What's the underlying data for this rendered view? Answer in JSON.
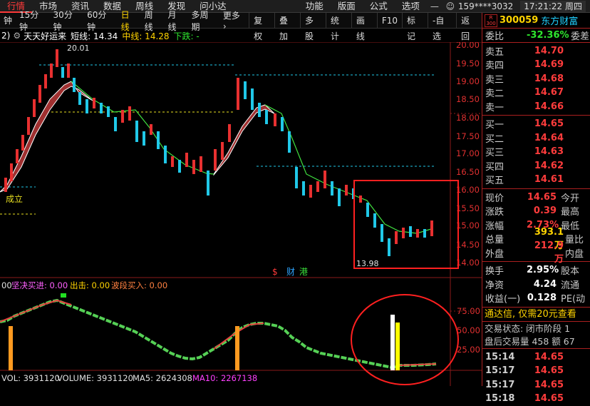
{
  "menu": {
    "items": [
      "行情",
      "市场",
      "资讯",
      "数据",
      "周线",
      "发现",
      "问小达",
      "功能",
      "版面",
      "公式",
      "选项"
    ],
    "account": "159****3032",
    "clock": "17:21:22 周四"
  },
  "toolbar": {
    "periods": [
      "钟",
      "15分钟",
      "30分钟",
      "60分钟",
      "日线",
      "周线",
      "月线",
      "多周期",
      "更多"
    ],
    "active_period": "日线",
    "buttons": [
      "复权",
      "叠加",
      "多股",
      "统计",
      "画线",
      "F10",
      "标记",
      "-自选",
      "返回"
    ]
  },
  "info": {
    "prefix": "2)",
    "indicator": "天天好运来",
    "short_line": "短线: 14.34",
    "mid_line": "中线: 14.28",
    "down": "下跌: -"
  },
  "chart": {
    "price_axis": [
      "20.00",
      "19.50",
      "19.00",
      "18.50",
      "18.00",
      "17.50",
      "17.00",
      "16.50",
      "16.00",
      "15.50",
      "15.00",
      "14.50",
      "14.00"
    ],
    "high_label": "20.01",
    "low_label": "13.98",
    "left_label": "成立",
    "bottom_marks": [
      "$",
      "财",
      "港"
    ],
    "sub_indicator": {
      "prefix": "00",
      "a": "坚决买进: 0.00",
      "b": "出击: 0.00",
      "c": "波段买入: 0.00",
      "axis": [
        "75.00",
        "50.00",
        "25.00"
      ]
    },
    "volume": {
      "vol": "VOL: 3931120",
      "volume": "VOLUME: 3931120",
      "ma5": "MA5: 2624308",
      "ma10": "MA10: 2267138"
    }
  },
  "quote": {
    "code": "300059",
    "name": "东方财富",
    "badge_top": "R",
    "badge_bot": "300",
    "wb": {
      "label": "委比",
      "value": "-32.36%",
      "right": "委差"
    },
    "asks": [
      {
        "l": "卖五",
        "p": "14.70"
      },
      {
        "l": "卖四",
        "p": "14.69"
      },
      {
        "l": "卖三",
        "p": "14.68"
      },
      {
        "l": "卖二",
        "p": "14.67"
      },
      {
        "l": "卖一",
        "p": "14.66"
      }
    ],
    "bids": [
      {
        "l": "买一",
        "p": "14.65"
      },
      {
        "l": "买二",
        "p": "14.64"
      },
      {
        "l": "买三",
        "p": "14.63"
      },
      {
        "l": "买四",
        "p": "14.62"
      },
      {
        "l": "买五",
        "p": "14.61"
      }
    ],
    "stats": [
      {
        "l": "现价",
        "v": "14.65",
        "r": "今开",
        "c": "red"
      },
      {
        "l": "涨跌",
        "v": "0.39",
        "r": "最高",
        "c": "red"
      },
      {
        "l": "涨幅",
        "v": "2.73%",
        "r": "最低",
        "c": "red"
      },
      {
        "l": "总量",
        "v": "393.1万",
        "r": "量比",
        "c": "yellow"
      },
      {
        "l": "外盘",
        "v": "212.9万",
        "r": "内盘",
        "c": "red"
      }
    ],
    "stats2": [
      {
        "l": "换手",
        "v": "2.95%",
        "r": "股本"
      },
      {
        "l": "净资",
        "v": "4.24",
        "r": "流通"
      },
      {
        "l": "收益(一)",
        "v": "0.128",
        "r": "PE(动"
      }
    ],
    "ad": "通达信, 仅需20元查看",
    "status": "交易状态: 闭市阶段 1",
    "after": "盘后交易量 458 额 67",
    "ticks": [
      {
        "t": "15:14",
        "p": "14.65"
      },
      {
        "t": "15:17",
        "p": "14.65"
      },
      {
        "t": "15:17",
        "p": "14.65"
      },
      {
        "t": "15:18",
        "p": "14.65"
      }
    ]
  }
}
